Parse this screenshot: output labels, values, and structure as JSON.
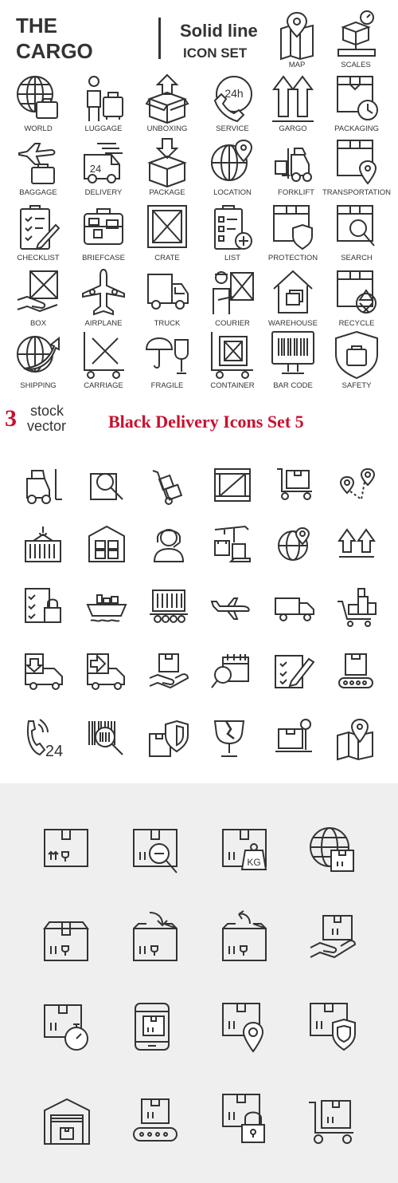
{
  "header": {
    "title_line1": "THE",
    "title_line2": "CARGO",
    "subtitle_line1": "Solid line",
    "subtitle_line2": "ICON SET"
  },
  "cargo_icons": {
    "map": "MAP",
    "scales": "SCALES",
    "world": "WORLD",
    "luggage": "LUGGAGE",
    "unboxing": "UNBOXING",
    "service": "SERVICE",
    "gargo": "GARGO",
    "packaging": "PACKAGING",
    "baggage": "BAGGAGE",
    "delivery": "DELIVERY",
    "package": "PACKAGE",
    "location": "LOCATION",
    "forklift": "FORKLIFT",
    "transportation": "TRANSPORTATION",
    "checklist": "CHECKLIST",
    "briefcase": "BRIEFCASE",
    "crate": "CRATE",
    "list": "LIST",
    "protection": "PROTECTION",
    "search": "SEARCH",
    "box": "BOX",
    "airplane": "AIRPLANE",
    "truck": "TRUCK",
    "courier": "COURIER",
    "warehouse": "WAREHOUSE",
    "recycle": "RECYCLE",
    "shipping": "SHIPPING",
    "carriage": "CARRIAGE",
    "fragile": "FRAGILE",
    "container": "CONTAINER",
    "bar_code": "BAR CODE",
    "safety": "SAFETY",
    "service_badge": "24h",
    "delivery_badge": "24"
  },
  "watermark": {
    "number": "3",
    "word1": "stock",
    "word2": "vector",
    "title": "Black Delivery Icons Set 5"
  },
  "set2": {
    "phone_badge": "24"
  },
  "set3": {
    "weight_badge": "KG"
  },
  "colors": {
    "line": "#333333",
    "accent": "#c8102e",
    "panel_bg": "#efefef"
  }
}
